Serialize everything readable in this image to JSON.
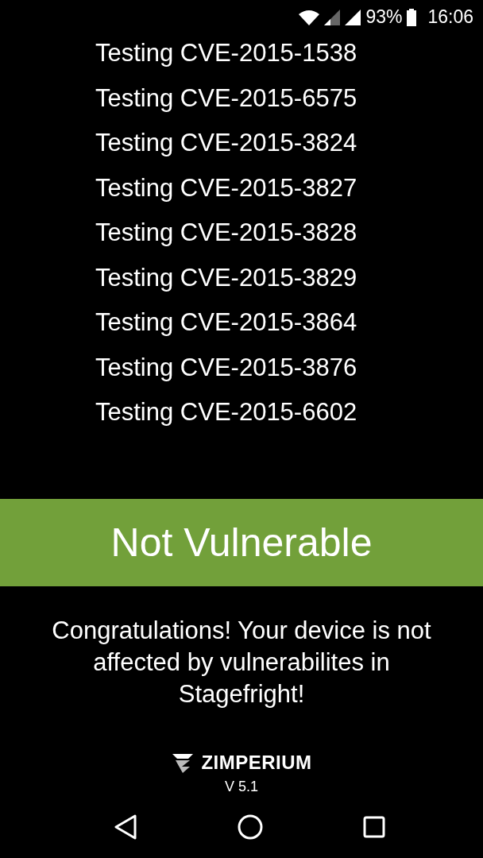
{
  "status_bar": {
    "battery": "93%",
    "time": "16:06"
  },
  "tests": [
    "Testing CVE-2015-1538",
    "Testing CVE-2015-6575",
    "Testing CVE-2015-3824",
    "Testing CVE-2015-3827",
    "Testing CVE-2015-3828",
    "Testing CVE-2015-3829",
    "Testing CVE-2015-3864",
    "Testing CVE-2015-3876",
    "Testing CVE-2015-6602"
  ],
  "result": {
    "title": "Not Vulnerable",
    "vulnerable": false
  },
  "message": "Congratulations! Your device is not affected by vulnerabilites in Stagefright!",
  "brand": "ZIMPERIUM",
  "version": "V 5.1"
}
